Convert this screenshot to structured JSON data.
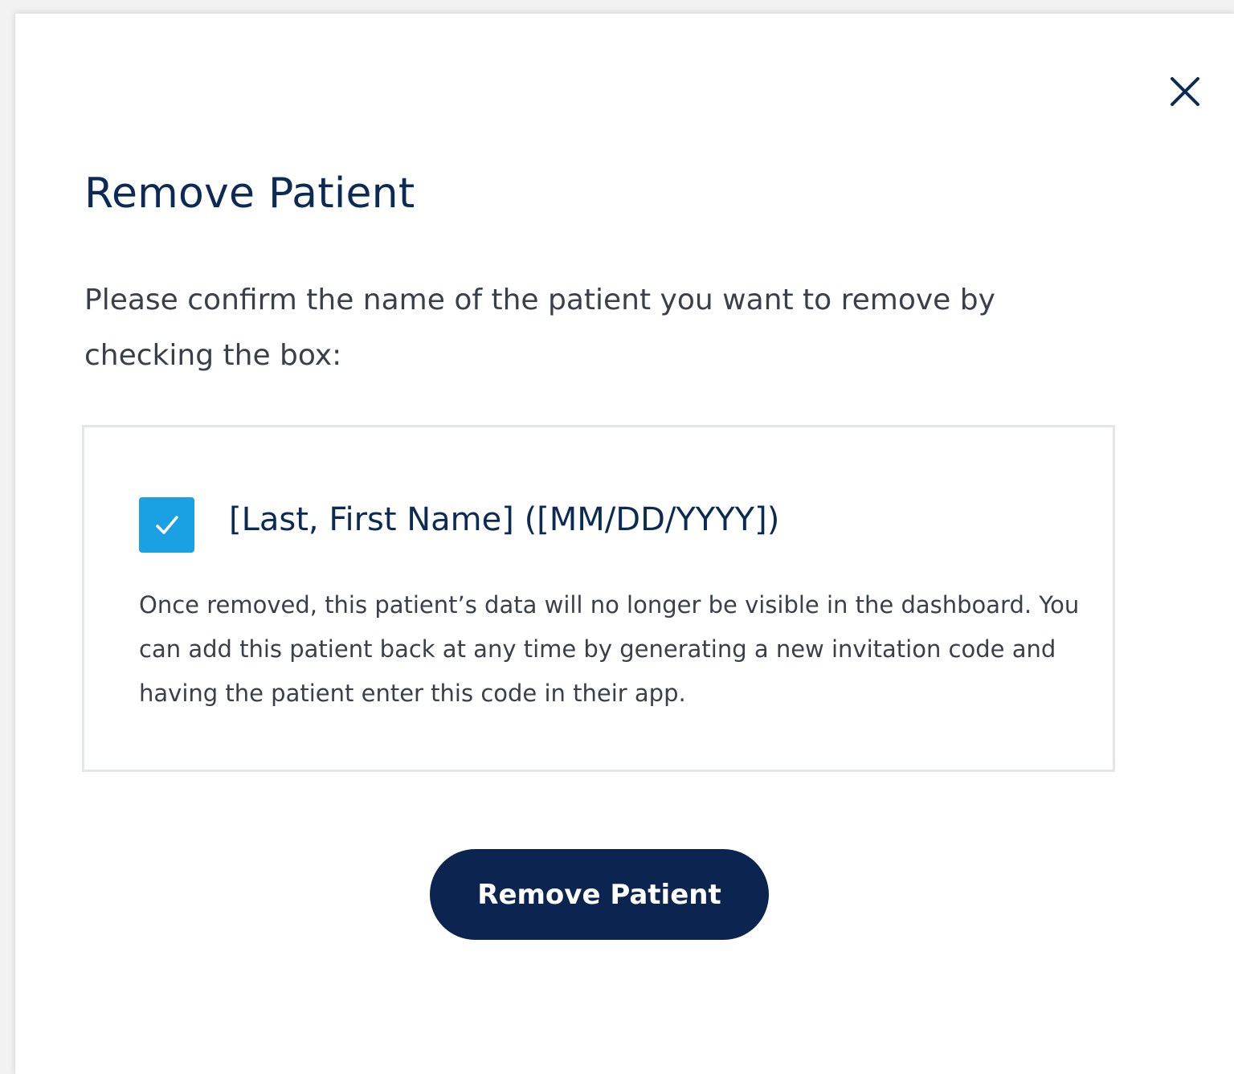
{
  "dialog": {
    "title": "Remove Patient",
    "instructions": "Please confirm the name of the patient you want to remove by checking the box:",
    "close_icon": "close-icon",
    "colors": {
      "title": "#0b2a55",
      "body_text": "#39404a",
      "checkbox": "#1aa1e3",
      "primary_button": "#0b2450",
      "box_border": "#e2e6ea"
    }
  },
  "confirmation": {
    "checked": true,
    "patient_label": "[Last, First Name] ([MM/DD/YYYY])",
    "note": "Once removed, this patient’s data will no longer be visible in the dashboard. You can add this patient back at any time by generating a new invitation code and having the patient enter this code in their app."
  },
  "actions": {
    "remove_label": "Remove Patient"
  }
}
